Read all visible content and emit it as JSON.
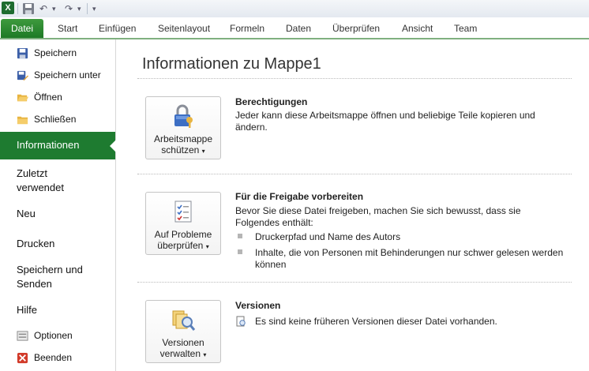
{
  "qat": {
    "undo": "↶",
    "redo": "↷",
    "customize": "▾"
  },
  "tabs": [
    "Start",
    "Einfügen",
    "Seitenlayout",
    "Formeln",
    "Daten",
    "Überprüfen",
    "Ansicht",
    "Team"
  ],
  "file_tab": "Datei",
  "sidebar": {
    "save": "Speichern",
    "save_as": "Speichern unter",
    "open": "Öffnen",
    "close": "Schließen",
    "info": "Informationen",
    "recent_1": "Zuletzt",
    "recent_2": "verwendet",
    "new": "Neu",
    "print": "Drucken",
    "send_1": "Speichern und",
    "send_2": "Senden",
    "help": "Hilfe",
    "options": "Optionen",
    "exit": "Beenden"
  },
  "main": {
    "title": "Informationen zu Mappe1",
    "permissions": {
      "btn_l1": "Arbeitsmappe",
      "btn_l2": "schützen",
      "heading": "Berechtigungen",
      "text": "Jeder kann diese Arbeitsmappe öffnen und beliebige Teile kopieren und ändern."
    },
    "prepare": {
      "btn_l1": "Auf Probleme",
      "btn_l2": "überprüfen",
      "heading": "Für die Freigabe vorbereiten",
      "text": "Bevor Sie diese Datei freigeben, machen Sie sich bewusst, dass sie Folgendes enthält:",
      "bullet1": "Druckerpfad und Name des Autors",
      "bullet2": "Inhalte, die von Personen mit Behinderungen nur schwer gelesen werden können"
    },
    "versions": {
      "btn_l1": "Versionen",
      "btn_l2": "verwalten",
      "heading": "Versionen",
      "text": "Es sind keine früheren Versionen dieser Datei vorhanden."
    }
  },
  "colors": {
    "accent": "#1e7b30",
    "tab_border": "#7fb07f"
  }
}
